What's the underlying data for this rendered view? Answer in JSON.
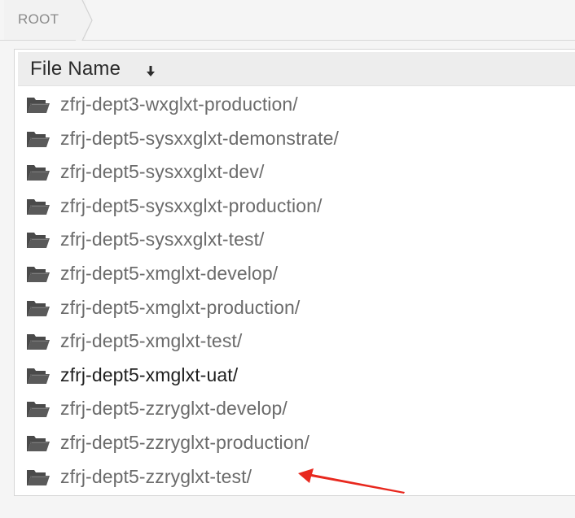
{
  "breadcrumb": {
    "root_label": "ROOT"
  },
  "file_list": {
    "header_label": "File Name",
    "sort_icon": "sort-descending-arrow",
    "folder_icon": "open-folder",
    "rows": [
      {
        "name": "zfrj-dept3-wxglxt-production/"
      },
      {
        "name": "zfrj-dept5-sysxxglxt-demonstrate/"
      },
      {
        "name": "zfrj-dept5-sysxxglxt-dev/"
      },
      {
        "name": "zfrj-dept5-sysxxglxt-production/"
      },
      {
        "name": "zfrj-dept5-sysxxglxt-test/"
      },
      {
        "name": "zfrj-dept5-xmglxt-develop/"
      },
      {
        "name": "zfrj-dept5-xmglxt-production/"
      },
      {
        "name": "zfrj-dept5-xmglxt-test/"
      },
      {
        "name": "zfrj-dept5-xmglxt-uat/"
      },
      {
        "name": "zfrj-dept5-zzryglxt-develop/"
      },
      {
        "name": "zfrj-dept5-zzryglxt-production/"
      },
      {
        "name": "zfrj-dept5-zzryglxt-test/"
      }
    ]
  },
  "colors": {
    "link_text": "#6b6b6b",
    "hover_text": "#1f1f1f",
    "header_bg": "#ededed",
    "annotation_arrow": "#e8281e"
  }
}
